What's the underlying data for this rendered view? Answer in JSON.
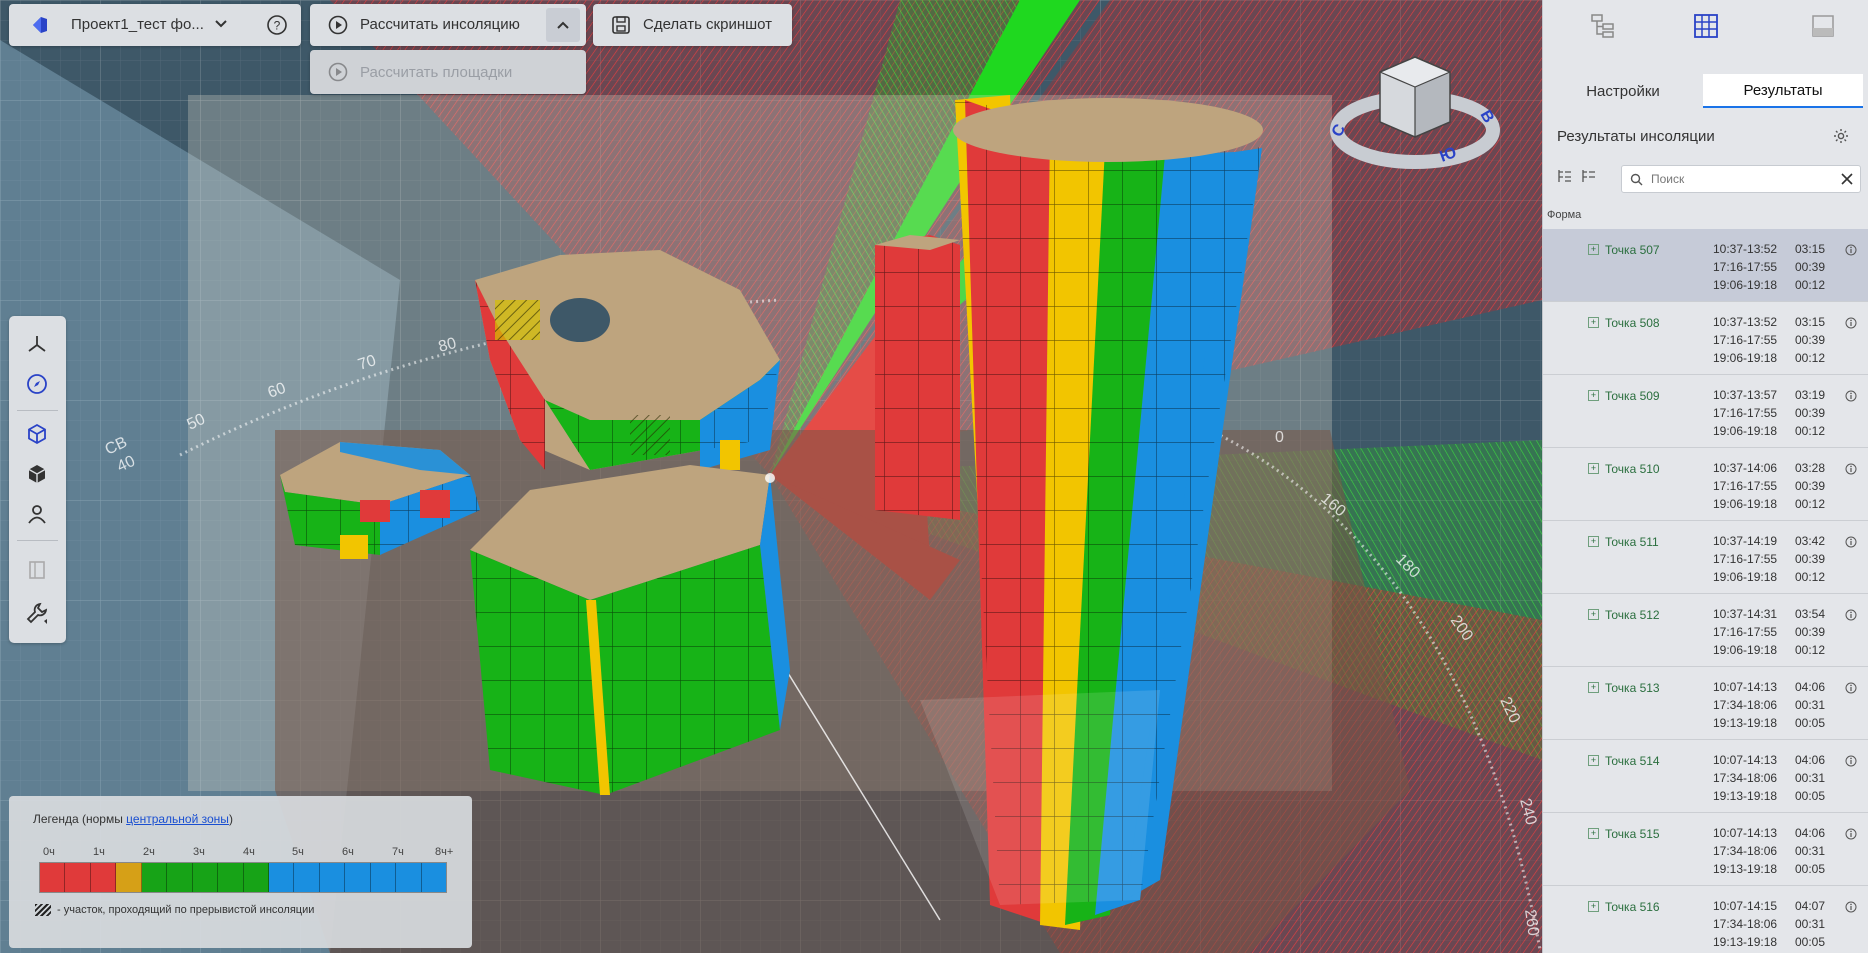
{
  "toolbar": {
    "project_name": "Проект1_тест фо...",
    "calc_insolation_label": "Рассчитать инсоляцию",
    "calc_areas_label": "Рассчитать площадки",
    "screenshot_label": "Сделать скриншот"
  },
  "compass": {
    "labels": [
      "С",
      "В",
      "Ю"
    ]
  },
  "scene": {
    "labels": [
      "СВ",
      "60",
      "70",
      "80",
      "0",
      "160",
      "180",
      "200",
      "220",
      "240",
      "260",
      "40",
      "50"
    ]
  },
  "legend": {
    "title_prefix": "Легенда (нормы ",
    "title_link": "центральной зоны",
    "title_suffix": ")",
    "ticks": [
      "0ч",
      "1ч",
      "2ч",
      "3ч",
      "4ч",
      "5ч",
      "6ч",
      "7ч",
      "8ч+"
    ],
    "colors": [
      "#e03a3a",
      "#e03a3a",
      "#e03a3a",
      "#d6a017",
      "#17a317",
      "#17a317",
      "#17a317",
      "#17a317",
      "#17a317",
      "#1a8fe0",
      "#1a8fe0",
      "#1a8fe0",
      "#1a8fe0",
      "#1a8fe0",
      "#1a8fe0",
      "#1a8fe0"
    ],
    "note": "- участок, проходящий по прерывистой инсоляции"
  },
  "right_panel": {
    "tabs": {
      "settings": "Настройки",
      "results": "Результаты"
    },
    "header": "Результаты инсоляции",
    "search_placeholder": "Поиск",
    "column_header": "Форма",
    "results": [
      {
        "name": "Точка 507",
        "times": [
          "10:37-13:52",
          "17:16-17:55",
          "19:06-19:18"
        ],
        "durations": [
          "03:15",
          "00:39",
          "00:12"
        ]
      },
      {
        "name": "Точка 508",
        "times": [
          "10:37-13:52",
          "17:16-17:55",
          "19:06-19:18"
        ],
        "durations": [
          "03:15",
          "00:39",
          "00:12"
        ]
      },
      {
        "name": "Точка 509",
        "times": [
          "10:37-13:57",
          "17:16-17:55",
          "19:06-19:18"
        ],
        "durations": [
          "03:19",
          "00:39",
          "00:12"
        ]
      },
      {
        "name": "Точка 510",
        "times": [
          "10:37-14:06",
          "17:16-17:55",
          "19:06-19:18"
        ],
        "durations": [
          "03:28",
          "00:39",
          "00:12"
        ]
      },
      {
        "name": "Точка 511",
        "times": [
          "10:37-14:19",
          "17:16-17:55",
          "19:06-19:18"
        ],
        "durations": [
          "03:42",
          "00:39",
          "00:12"
        ]
      },
      {
        "name": "Точка 512",
        "times": [
          "10:37-14:31",
          "17:16-17:55",
          "19:06-19:18"
        ],
        "durations": [
          "03:54",
          "00:39",
          "00:12"
        ]
      },
      {
        "name": "Точка 513",
        "times": [
          "10:07-14:13",
          "17:34-18:06",
          "19:13-19:18"
        ],
        "durations": [
          "04:06",
          "00:31",
          "00:05"
        ]
      },
      {
        "name": "Точка 514",
        "times": [
          "10:07-14:13",
          "17:34-18:06",
          "19:13-19:18"
        ],
        "durations": [
          "04:06",
          "00:31",
          "00:05"
        ]
      },
      {
        "name": "Точка 515",
        "times": [
          "10:07-14:13",
          "17:34-18:06",
          "19:13-19:18"
        ],
        "durations": [
          "04:06",
          "00:31",
          "00:05"
        ]
      },
      {
        "name": "Точка 516",
        "times": [
          "10:07-14:15",
          "17:34-18:06",
          "19:13-19:18"
        ],
        "durations": [
          "04:07",
          "00:31",
          "00:05"
        ]
      }
    ]
  }
}
